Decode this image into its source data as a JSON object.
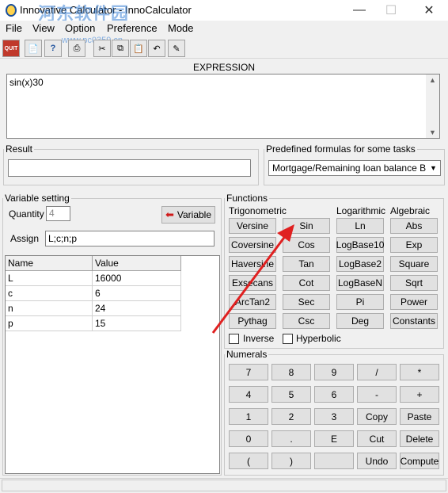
{
  "window": {
    "title": "Innovative Calculator - InnoCalculator",
    "watermark": "河东软件园",
    "watermark_url": "www.pc0359.cn"
  },
  "menu": [
    "File",
    "View",
    "Option",
    "Preference",
    "Mode"
  ],
  "toolbar": {
    "icons": [
      "quit-icon",
      "document-icon",
      "help-icon",
      "print-icon",
      "cut-icon",
      "copy-icon",
      "paste-icon",
      "undo-icon",
      "clear-icon"
    ],
    "quit_label": "QUIT",
    "help_label": "?"
  },
  "expression": {
    "label": "EXPRESSION",
    "value": "sin(x)30"
  },
  "result": {
    "label": "Result",
    "value": ""
  },
  "predefined": {
    "label": "Predefined formulas for some tasks",
    "selected": "Mortgage/Remaining loan balance B"
  },
  "variable_setting": {
    "label": "Variable setting",
    "quantity_label": "Quantity",
    "quantity_value": "4",
    "variable_button": "Variable",
    "assign_label": "Assign",
    "assign_value": "L;c;n;p",
    "columns": [
      "Name",
      "Value"
    ],
    "rows": [
      {
        "name": "L",
        "value": "16000"
      },
      {
        "name": "c",
        "value": "6"
      },
      {
        "name": "n",
        "value": "24"
      },
      {
        "name": "p",
        "value": "15"
      }
    ]
  },
  "functions": {
    "label": "Functions",
    "trig_label": "Trigonometric",
    "log_label": "Logarithmic",
    "alg_label": "Algebraic",
    "trig_left": [
      "Versine",
      "Coversine",
      "Haversine",
      "Exsecans",
      "ArcTan2",
      "Pythag"
    ],
    "trig_right": [
      "Sin",
      "Cos",
      "Tan",
      "Cot",
      "Sec",
      "Csc"
    ],
    "logarithmic": [
      "Ln",
      "LogBase10",
      "LogBase2",
      "LogBaseN",
      "Pi",
      "Deg"
    ],
    "algebraic": [
      "Abs",
      "Exp",
      "Square",
      "Sqrt",
      "Power",
      "Constants"
    ],
    "inverse_label": "Inverse",
    "hyperbolic_label": "Hyperbolic"
  },
  "numerals": {
    "label": "Numerals",
    "rows": [
      [
        "7",
        "8",
        "9",
        "/",
        "*"
      ],
      [
        "4",
        "5",
        "6",
        "-",
        "+"
      ],
      [
        "1",
        "2",
        "3",
        "Copy",
        "Paste"
      ],
      [
        "0",
        ".",
        "E",
        "Cut",
        "Delete"
      ],
      [
        "(",
        ")",
        "",
        "Undo",
        "Compute"
      ]
    ]
  },
  "colors": {
    "arrow": "#e02020",
    "window_bg": "#f0f0f0"
  }
}
